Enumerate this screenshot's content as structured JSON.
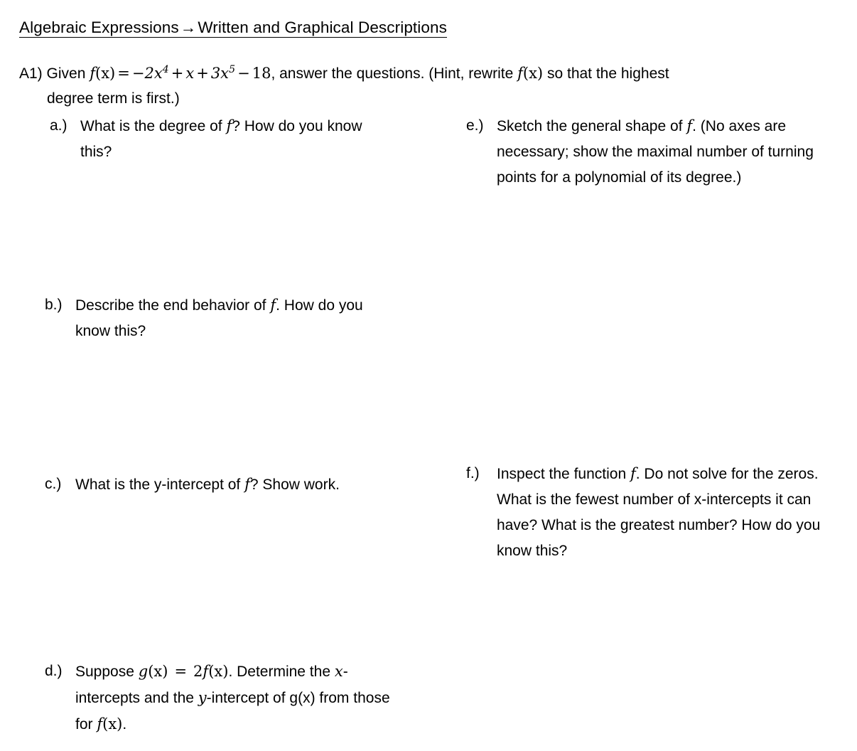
{
  "document": {
    "title": "Algebraic Expressions → Written and Graphical Descriptions",
    "title_part_1": "Algebraic Expressions",
    "title_arrow": "→",
    "title_part_2": "Written and Graphical Descriptions"
  },
  "problem": {
    "number": "A1)",
    "stem_before_function": "Given",
    "function_label": "f",
    "function_arg": "(x)",
    "equals": "=",
    "term_1": "−2x",
    "term_1_exp": "4",
    "plus_1": "+",
    "term_2": "x",
    "plus_2": "+",
    "term_3": "3x",
    "term_3_exp": "5",
    "minus": "−",
    "term_4": "18",
    "stem_after_function": ", answer the questions.  (Hint, rewrite",
    "hint_function": "f(x)",
    "stem_tail": "so that the highest",
    "stem_line_2": "degree term is first.)",
    "function_expression_plain": "f(x) = −2x⁴ + x + 3x⁵ − 18"
  },
  "questions": {
    "left": [
      {
        "marker": "a.)",
        "text_before_math": "What is the degree of",
        "math": "f",
        "text_after_math": "?  How do you know this?",
        "full_text": "What is the degree of f?  How do you know this?"
      },
      {
        "marker": "b.)",
        "text_before_math": "Describe the end behavior of",
        "math": "f",
        "text_after_math": ". How do you know this?",
        "full_text": "Describe the end behavior of f. How do you know this?"
      },
      {
        "marker": "c.)",
        "text_before_math": "What is the y-intercept of",
        "math": "f",
        "text_after_math": "?  Show work.",
        "full_text": "What is the y-intercept of f?  Show work."
      },
      {
        "marker": "d.)",
        "text_before_math": "Suppose",
        "math_g": "g(x)",
        "math_equals": "=",
        "math_2f": "2f(x)",
        "text_mid": ".  Determine the",
        "var_x": "x",
        "text_x_intercepts": "-intercepts and the",
        "var_y": "y",
        "text_y_intercept": "-intercept of",
        "plain_g": "g(x)",
        "text_from": "from those for",
        "math_f": "f(x)",
        "text_end": ".",
        "full_text": "Suppose g(x) = 2f(x).  Determine the x-intercepts and the y-intercept of g(x) from those for f(x)."
      }
    ],
    "right": [
      {
        "marker": "e.)",
        "text_before_math": "Sketch the general shape of",
        "math": "f",
        "text_after_math": ".  (No axes are necessary; show the maximal number of turning points for a polynomial of its degree.)",
        "full_text": "Sketch the general shape of f.  (No axes are necessary; show the maximal number of turning points for a polynomial of its degree.)"
      },
      {
        "marker": "f.)",
        "text_before_math": "Inspect the function",
        "math": "f",
        "text_after_math": ".  Do not solve for the zeros.  What is the fewest number of x-intercepts it can have?  What is the greatest number? How do you know this?",
        "full_text": "Inspect the function f.  Do not solve for the zeros.  What is the fewest number of x-intercepts it can have?  What is the greatest number? How do you know this?"
      }
    ]
  },
  "colors": {
    "page_background": "#ffffff",
    "text": "#000000",
    "rule": "#000000"
  }
}
